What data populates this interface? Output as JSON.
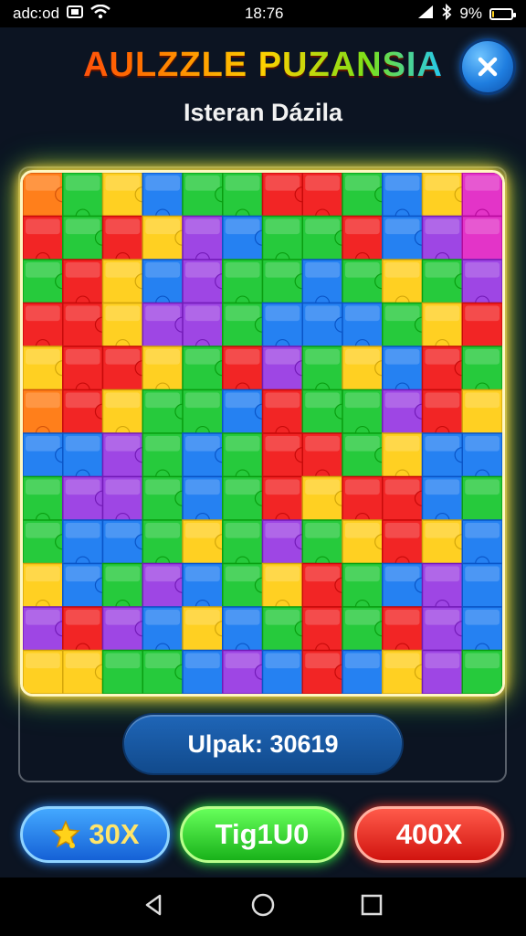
{
  "status_bar": {
    "carrier": "adc:od",
    "time": "18:76",
    "battery_text": "9%",
    "battery_level": 0.09,
    "icons": [
      "sim-icon",
      "wifi-icon",
      "signal-icon",
      "bluetooth-icon",
      "battery-icon"
    ]
  },
  "header": {
    "title": "AULZZLE PUZANSIA",
    "subtitle": "Isteran Dázila",
    "close_icon": "close-icon"
  },
  "board": {
    "rows": 12,
    "cols": 12,
    "palette": {
      "R": "#f21d1d",
      "O": "#ff7a12",
      "Y": "#ffcf1a",
      "G": "#1ec835",
      "B": "#1d7cf2",
      "P": "#9b3fe3",
      "M": "#e22cc6"
    },
    "tiles": [
      "OGYBGGRRGBYM",
      "RGRYPBGGRBPM",
      "GRYBPGGBGYGP",
      "RRYPPGBBBGYR",
      "YRRYGRPGYBRG",
      "ORYGGBRGGPRY",
      "BBPGBGRRGYBB",
      "GPPGBGRYRRBG",
      "GBBGYGPGYRYB",
      "YBGPBGYRGBPB",
      "PRPBYBGRGRPB",
      "YYGGBPBRBYPG"
    ]
  },
  "score": {
    "label": "Ulpak: 30619"
  },
  "buttons": {
    "left_label": "30X",
    "left_icon": "star-icon",
    "middle_label": "Tig1U0",
    "right_label": "400X"
  },
  "colors": {
    "background": "#0c1422",
    "blue_button": "#1561d6",
    "green_button": "#19b21a",
    "red_button": "#d1140f",
    "board_glow": "#ffe14d"
  }
}
